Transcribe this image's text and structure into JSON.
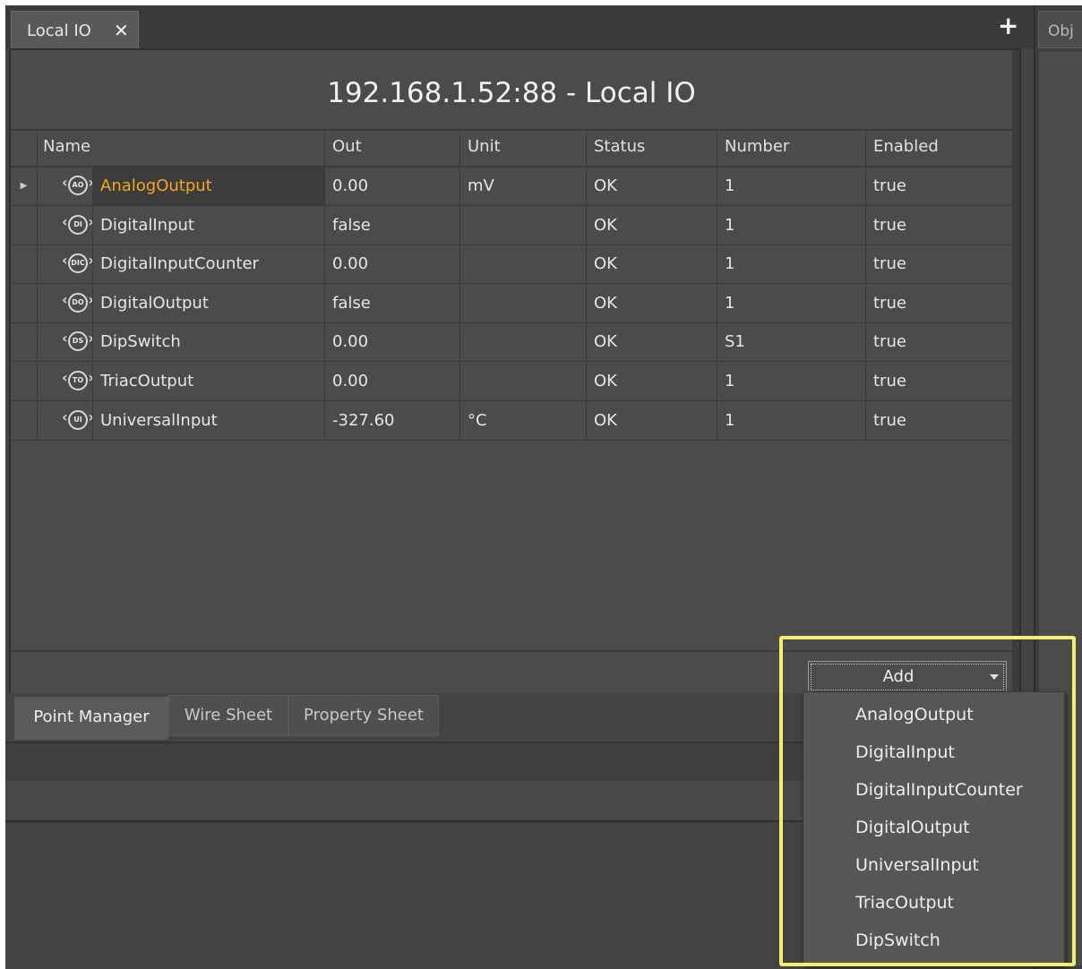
{
  "tab": {
    "title": "Local IO",
    "close_glyph": "✕"
  },
  "plus_glyph": "+",
  "side_tab": {
    "label": "Obj"
  },
  "pane": {
    "title": "192.168.1.52:88 - Local IO"
  },
  "table": {
    "columns": [
      "Name",
      "Out",
      "Unit",
      "Status",
      "Number",
      "Enabled"
    ],
    "rows": [
      {
        "badge": "AO",
        "name": "AnalogOutput",
        "out": "0.00",
        "unit": "mV",
        "status": "OK",
        "number": "1",
        "enabled": "true",
        "selected": true
      },
      {
        "badge": "DI",
        "name": "DigitalInput",
        "out": "false",
        "unit": "",
        "status": "OK",
        "number": "1",
        "enabled": "true"
      },
      {
        "badge": "DIC",
        "name": "DigitalInputCounter",
        "out": "0.00",
        "unit": "",
        "status": "OK",
        "number": "1",
        "enabled": "true"
      },
      {
        "badge": "DO",
        "name": "DigitalOutput",
        "out": "false",
        "unit": "",
        "status": "OK",
        "number": "1",
        "enabled": "true"
      },
      {
        "badge": "DS",
        "name": "DipSwitch",
        "out": "0.00",
        "unit": "",
        "status": "OK",
        "number": "S1",
        "enabled": "true"
      },
      {
        "badge": "TO",
        "name": "TriacOutput",
        "out": "0.00",
        "unit": "",
        "status": "OK",
        "number": "1",
        "enabled": "true"
      },
      {
        "badge": "UI",
        "name": "UniversalInput",
        "out": "-327.60",
        "unit": "°C",
        "status": "OK",
        "number": "1",
        "enabled": "true"
      }
    ]
  },
  "add_button": {
    "label": "Add"
  },
  "view_tabs": [
    "Point Manager",
    "Wire Sheet",
    "Property Sheet"
  ],
  "dropdown_items": [
    "AnalogOutput",
    "DigitalInput",
    "DigitalInputCounter",
    "DigitalOutput",
    "UniversalInput",
    "TriacOutput",
    "DipSwitch"
  ],
  "colors": {
    "selected_name": "#f0a81e",
    "highlight": "#f4ef6a",
    "background": "#434343"
  }
}
